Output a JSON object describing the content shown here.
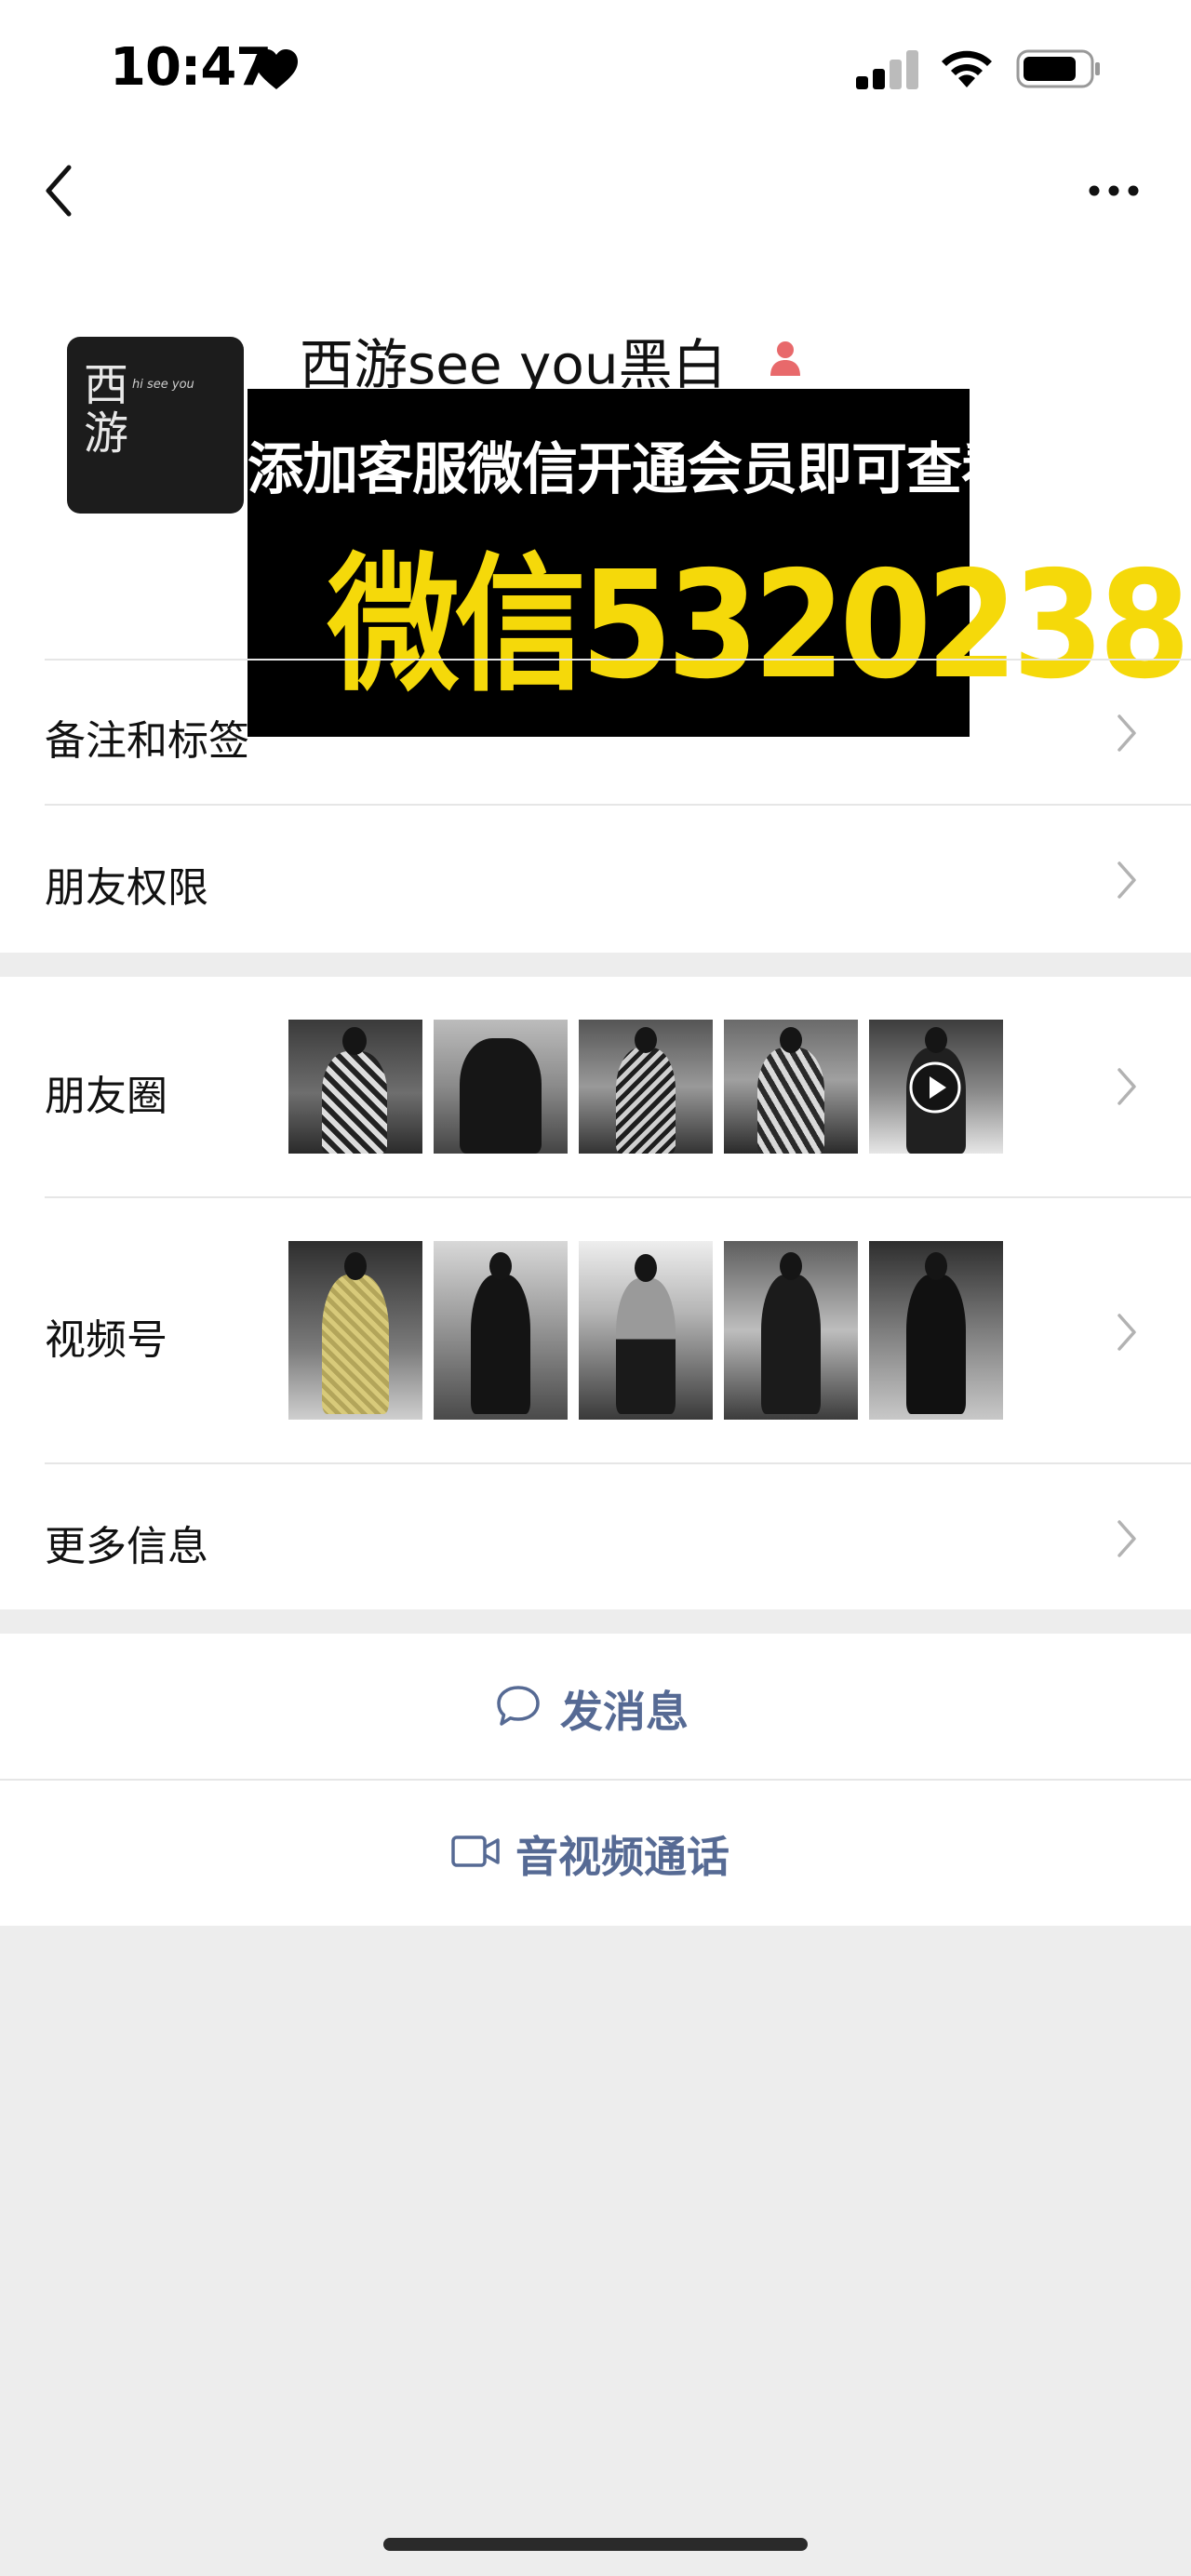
{
  "status_bar": {
    "time": "10:47"
  },
  "profile": {
    "name": "西游see you黑白",
    "avatar_text": "西游",
    "avatar_subtext": "hi see you"
  },
  "overlay": {
    "line1": "添加客服微信开通会员即可查看",
    "line2": "微信5320238"
  },
  "rows": {
    "remark": "备注和标签",
    "permissions": "朋友权限",
    "moments": "朋友圈",
    "channels": "视频号",
    "more_info": "更多信息"
  },
  "actions": {
    "message": "发消息",
    "call": "音视频通话"
  },
  "colors": {
    "overlay_yellow": "#f5d90a",
    "link_blue": "#566a94",
    "badge_red": "#e8696b"
  }
}
